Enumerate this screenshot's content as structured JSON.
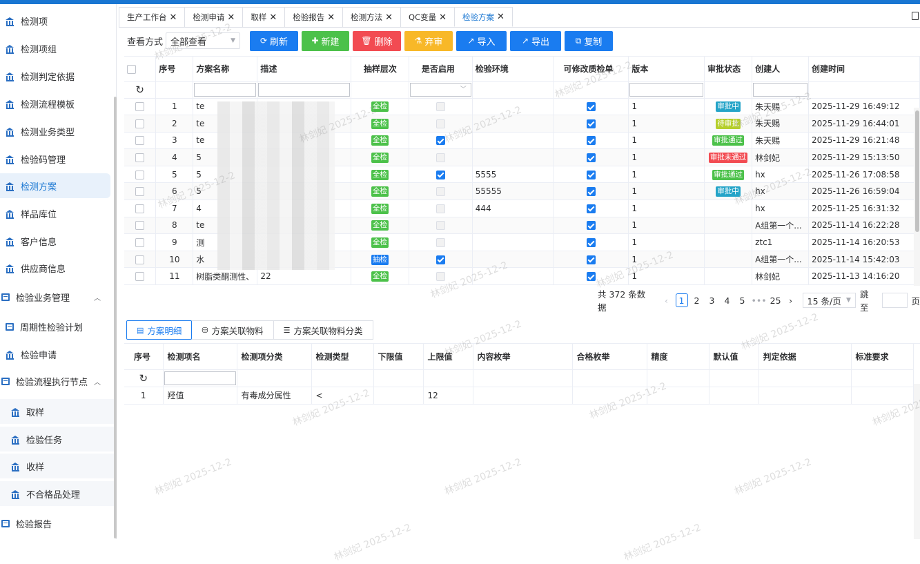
{
  "colors": {
    "accent": "#1a7cf0",
    "green": "#4cc14a",
    "red": "#f24b52",
    "yellow": "#f8b828"
  },
  "sidebar": {
    "items": [
      {
        "label": "检测项",
        "icon": "bank-icon"
      },
      {
        "label": "检测项组",
        "icon": "bank-icon"
      },
      {
        "label": "检测判定依据",
        "icon": "bank-icon"
      },
      {
        "label": "检测流程模板",
        "icon": "bank-icon"
      },
      {
        "label": "检测业务类型",
        "icon": "bank-icon"
      },
      {
        "label": "检验码管理",
        "icon": "bank-icon"
      },
      {
        "label": "检测方案",
        "icon": "bank-icon",
        "active": true
      },
      {
        "label": "样品库位",
        "icon": "bank-icon"
      },
      {
        "label": "客户信息",
        "icon": "bank-icon"
      },
      {
        "label": "供应商信息",
        "icon": "bank-icon"
      },
      {
        "label": "检验业务管理",
        "icon": "box-icon",
        "expanded": true
      },
      {
        "label": "周期性检验计划",
        "icon": "box-icon"
      },
      {
        "label": "检验申请",
        "icon": "bank-icon"
      },
      {
        "label": "检验流程执行节点",
        "icon": "box-icon",
        "expanded": true
      },
      {
        "label": "取样",
        "icon": "bank-icon"
      },
      {
        "label": "检验任务",
        "icon": "bank-icon"
      },
      {
        "label": "收样",
        "icon": "bank-icon"
      },
      {
        "label": "不合格品处理",
        "icon": "bank-icon"
      },
      {
        "label": "检验报告",
        "icon": "box-icon"
      }
    ]
  },
  "tabs": [
    "生产工作台",
    "检测申请",
    "取样",
    "检验报告",
    "检测方法",
    "QC变量",
    "检验方案"
  ],
  "toolbar": {
    "view_label": "查看方式",
    "view_value": "全部查看",
    "refresh": "刷新",
    "new": "新建",
    "delete": "删除",
    "abandon": "弃审",
    "import": "导入",
    "export": "导出",
    "copy": "复制"
  },
  "grid": {
    "headers": [
      "序号",
      "方案名称",
      "描述",
      "抽样层次",
      "是否启用",
      "检验环境",
      "可修改质检单",
      "版本",
      "审批状态",
      "创建人",
      "创建时间"
    ],
    "rows": [
      {
        "no": "1",
        "name": "te",
        "desc": "",
        "level": "全检",
        "enabled": false,
        "env": "",
        "editable": true,
        "ver": "1",
        "status": "审批中",
        "creator": "朱天赐",
        "time": "2025-11-29 16:49:12"
      },
      {
        "no": "2",
        "name": "te",
        "desc": "",
        "level": "全检",
        "enabled": false,
        "env": "",
        "editable": true,
        "ver": "1",
        "status": "待审批",
        "creator": "朱天赐",
        "time": "2025-11-29 16:44:01"
      },
      {
        "no": "3",
        "name": "te",
        "desc": "",
        "level": "全检",
        "enabled": true,
        "env": "",
        "editable": true,
        "ver": "1",
        "status": "审批通过",
        "creator": "朱天赐",
        "time": "2025-11-29 16:21:48"
      },
      {
        "no": "4",
        "name": "5",
        "desc": "",
        "level": "全检",
        "enabled": false,
        "env": "",
        "editable": true,
        "ver": "1",
        "status": "审批未通过",
        "creator": "林剑妃",
        "time": "2025-11-29 15:13:50"
      },
      {
        "no": "5",
        "name": "5",
        "desc": "",
        "level": "全检",
        "enabled": true,
        "env": "5555",
        "editable": true,
        "ver": "1",
        "status": "审批通过",
        "creator": "hx",
        "time": "2025-11-26 17:08:58"
      },
      {
        "no": "6",
        "name": "5",
        "desc": "",
        "level": "全检",
        "enabled": false,
        "env": "55555",
        "editable": true,
        "ver": "1",
        "status": "审批中",
        "creator": "hx",
        "time": "2025-11-26 16:59:04"
      },
      {
        "no": "7",
        "name": "4",
        "desc": "",
        "level": "全检",
        "enabled": false,
        "env": "444",
        "editable": true,
        "ver": "1",
        "status": "",
        "creator": "hx",
        "time": "2025-11-25 16:31:32"
      },
      {
        "no": "8",
        "name": "te",
        "desc": "",
        "level": "全检",
        "enabled": false,
        "env": "",
        "editable": true,
        "ver": "1",
        "status": "",
        "creator": "A组第一个...",
        "time": "2025-11-14 16:22:28"
      },
      {
        "no": "9",
        "name": "测",
        "desc": "",
        "level": "全检",
        "enabled": false,
        "env": "",
        "editable": true,
        "ver": "1",
        "status": "",
        "creator": "ztc1",
        "time": "2025-11-14 16:20:53"
      },
      {
        "no": "10",
        "name": "水",
        "desc": "",
        "level": "抽检",
        "enabled": true,
        "env": "",
        "editable": true,
        "ver": "1",
        "status": "",
        "creator": "A组第一个...",
        "time": "2025-11-14 15:42:03"
      },
      {
        "no": "11",
        "name": "树脂类酮测性、",
        "desc": "22",
        "level": "全检",
        "enabled": false,
        "env": "",
        "editable": true,
        "ver": "1",
        "status": "",
        "creator": "林剑妃",
        "time": "2025-11-13 14:16:20"
      }
    ]
  },
  "status_colors": {
    "审批中": "#25a4c8",
    "待审批": "#b5cf2b",
    "审批通过": "#4cc14a",
    "审批未通过": "#f24b52"
  },
  "level_colors": {
    "全检": "#4cc14a",
    "抽检": "#1a7cf0"
  },
  "pager": {
    "total": "共 372 条数据",
    "pages": [
      "1",
      "2",
      "3",
      "4",
      "5",
      "•••",
      "25"
    ],
    "page_size": "15 条/页",
    "jump_label": "跳至",
    "suffix": "页"
  },
  "bottom_tabs": [
    "方案明细",
    "方案关联物料",
    "方案关联物料分类"
  ],
  "detail": {
    "headers": [
      "序号",
      "检测项名",
      "检测项分类",
      "检测类型",
      "下限值",
      "上限值",
      "内容枚举",
      "合格枚举",
      "精度",
      "默认值",
      "判定依据",
      "标准要求"
    ],
    "rows": [
      [
        "1",
        "羟值",
        "有毒成分属性",
        "<",
        "",
        "12",
        "",
        "",
        "",
        "",
        "",
        ""
      ]
    ]
  },
  "watermark": "林剑妃 2025-12-2"
}
